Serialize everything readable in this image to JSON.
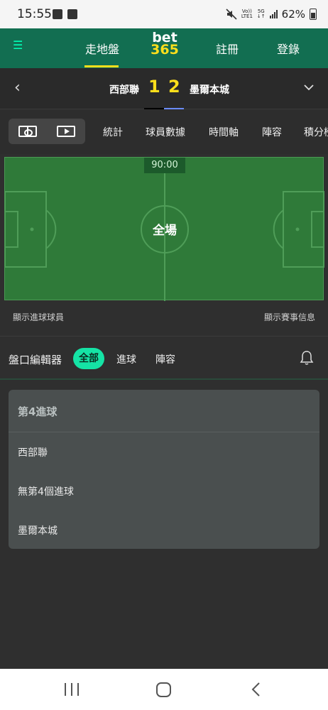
{
  "status_bar": {
    "time": "15:55",
    "network_top": "Vo))",
    "network_bottom": "LTE1",
    "signal_top": "5G",
    "signal_bottom": "↓↑",
    "battery": "62%"
  },
  "top_nav": {
    "menu_icon": "menu-icon",
    "items": [
      "走地盤",
      "註冊",
      "登錄"
    ],
    "logo_line1": "bet",
    "logo_line2": "365",
    "active_color": "#ffdf1b",
    "accent_color": "#126e51"
  },
  "match": {
    "home_team": "西部聯",
    "away_team": "墨爾本城",
    "home_score": "1",
    "away_score": "2"
  },
  "tabs": [
    "統計",
    "球員數據",
    "時間軸",
    "陣容",
    "積分榜"
  ],
  "pitch": {
    "clock": "90:00",
    "period": "全場",
    "show_scorers": "顯示進球球員",
    "show_match_info": "顯示賽事信息"
  },
  "filters": {
    "title": "盤口編輯器",
    "active": "全部",
    "items": [
      "進球",
      "陣容"
    ],
    "active_color": "#15e3a5"
  },
  "market": {
    "title": "第4進球",
    "options": [
      "西部聯",
      "無第4個進球",
      "墨爾本城"
    ]
  }
}
